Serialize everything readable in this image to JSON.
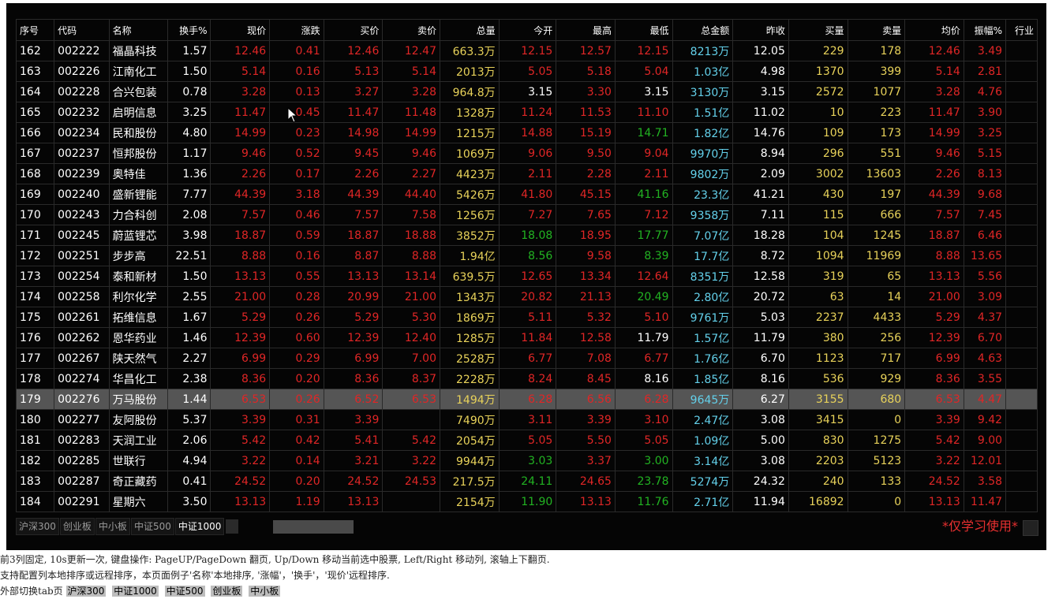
{
  "columns": [
    {
      "key": "no",
      "label": "序号"
    },
    {
      "key": "code",
      "label": "代码"
    },
    {
      "key": "name",
      "label": "名称"
    },
    {
      "key": "turnover",
      "label": "换手%"
    },
    {
      "key": "price",
      "label": "现价"
    },
    {
      "key": "change",
      "label": "涨跌"
    },
    {
      "key": "bid",
      "label": "买价"
    },
    {
      "key": "ask",
      "label": "卖价"
    },
    {
      "key": "volume",
      "label": "总量"
    },
    {
      "key": "open",
      "label": "今开"
    },
    {
      "key": "high",
      "label": "最高"
    },
    {
      "key": "low",
      "label": "最低"
    },
    {
      "key": "amount",
      "label": "总金额"
    },
    {
      "key": "prev_close",
      "label": "昨收"
    },
    {
      "key": "buy_vol",
      "label": "买量"
    },
    {
      "key": "sell_vol",
      "label": "卖量"
    },
    {
      "key": "avg",
      "label": "均价"
    },
    {
      "key": "amplitude",
      "label": "振幅%"
    },
    {
      "key": "industry",
      "label": "行业"
    }
  ],
  "colors": {
    "w": "#ffffff",
    "r": "#e02626",
    "g": "#22b322",
    "y": "#e8d25a",
    "c": "#63d0ea",
    "selected_row_bg": "#555555",
    "panel_bg": "#050505"
  },
  "selected_row": 17,
  "rows": [
    {
      "no": "162",
      "code": "002222",
      "name": "福晶科技",
      "turnover": "1.57",
      "price": "12.46",
      "change": "0.41",
      "bid": "12.46",
      "ask": "12.47",
      "volume": "663.3万",
      "open": "12.15",
      "high": "12.57",
      "low": "12.15",
      "amount": "8213万",
      "prev_close": "12.05",
      "buy_vol": "229",
      "sell_vol": "178",
      "avg": "12.46",
      "amplitude": "3.49",
      "industry": "",
      "colors": {
        "open": "r",
        "low": "r"
      }
    },
    {
      "no": "163",
      "code": "002226",
      "name": "江南化工",
      "turnover": "1.50",
      "price": "5.14",
      "change": "0.16",
      "bid": "5.13",
      "ask": "5.14",
      "volume": "2013万",
      "open": "5.05",
      "high": "5.18",
      "low": "5.04",
      "amount": "1.03亿",
      "prev_close": "4.98",
      "buy_vol": "1370",
      "sell_vol": "399",
      "avg": "5.14",
      "amplitude": "2.81",
      "industry": "",
      "colors": {
        "open": "r",
        "low": "r"
      }
    },
    {
      "no": "164",
      "code": "002228",
      "name": "合兴包装",
      "turnover": "0.78",
      "price": "3.28",
      "change": "0.13",
      "bid": "3.27",
      "ask": "3.28",
      "volume": "964.8万",
      "open": "3.15",
      "high": "3.30",
      "low": "3.15",
      "amount": "3130万",
      "prev_close": "3.15",
      "buy_vol": "2572",
      "sell_vol": "1077",
      "avg": "3.28",
      "amplitude": "4.76",
      "industry": "",
      "colors": {
        "open": "w",
        "low": "w"
      }
    },
    {
      "no": "165",
      "code": "002232",
      "name": "启明信息",
      "turnover": "3.25",
      "price": "11.47",
      "change": "0.45",
      "bid": "11.47",
      "ask": "11.48",
      "volume": "1328万",
      "open": "11.24",
      "high": "11.53",
      "low": "11.10",
      "amount": "1.51亿",
      "prev_close": "11.02",
      "buy_vol": "10",
      "sell_vol": "223",
      "avg": "11.47",
      "amplitude": "3.90",
      "industry": "",
      "colors": {
        "open": "r",
        "low": "r"
      }
    },
    {
      "no": "166",
      "code": "002234",
      "name": "民和股份",
      "turnover": "4.80",
      "price": "14.99",
      "change": "0.23",
      "bid": "14.98",
      "ask": "14.99",
      "volume": "1215万",
      "open": "14.88",
      "high": "15.19",
      "low": "14.71",
      "amount": "1.82亿",
      "prev_close": "14.76",
      "buy_vol": "109",
      "sell_vol": "173",
      "avg": "14.99",
      "amplitude": "3.25",
      "industry": "",
      "colors": {
        "open": "r",
        "low": "g"
      }
    },
    {
      "no": "167",
      "code": "002237",
      "name": "恒邦股份",
      "turnover": "1.17",
      "price": "9.46",
      "change": "0.52",
      "bid": "9.45",
      "ask": "9.46",
      "volume": "1069万",
      "open": "9.06",
      "high": "9.50",
      "low": "9.04",
      "amount": "9970万",
      "prev_close": "8.94",
      "buy_vol": "296",
      "sell_vol": "551",
      "avg": "9.46",
      "amplitude": "5.15",
      "industry": "",
      "colors": {
        "open": "r",
        "low": "r"
      }
    },
    {
      "no": "168",
      "code": "002239",
      "name": "奥特佳",
      "turnover": "1.36",
      "price": "2.26",
      "change": "0.17",
      "bid": "2.26",
      "ask": "2.27",
      "volume": "4423万",
      "open": "2.11",
      "high": "2.28",
      "low": "2.11",
      "amount": "9802万",
      "prev_close": "2.09",
      "buy_vol": "3002",
      "sell_vol": "13603",
      "avg": "2.26",
      "amplitude": "8.13",
      "industry": "",
      "colors": {
        "open": "r",
        "low": "r"
      }
    },
    {
      "no": "169",
      "code": "002240",
      "name": "盛新锂能",
      "turnover": "7.77",
      "price": "44.39",
      "change": "3.18",
      "bid": "44.39",
      "ask": "44.40",
      "volume": "5426万",
      "open": "41.80",
      "high": "45.15",
      "low": "41.16",
      "amount": "23.3亿",
      "prev_close": "41.21",
      "buy_vol": "430",
      "sell_vol": "197",
      "avg": "44.39",
      "amplitude": "9.68",
      "industry": "",
      "colors": {
        "open": "r",
        "low": "g"
      }
    },
    {
      "no": "170",
      "code": "002243",
      "name": "力合科创",
      "turnover": "2.08",
      "price": "7.57",
      "change": "0.46",
      "bid": "7.57",
      "ask": "7.58",
      "volume": "1256万",
      "open": "7.27",
      "high": "7.65",
      "low": "7.12",
      "amount": "9358万",
      "prev_close": "7.11",
      "buy_vol": "115",
      "sell_vol": "666",
      "avg": "7.57",
      "amplitude": "7.45",
      "industry": "",
      "colors": {
        "open": "r",
        "low": "r"
      }
    },
    {
      "no": "171",
      "code": "002245",
      "name": "蔚蓝锂芯",
      "turnover": "3.98",
      "price": "18.87",
      "change": "0.59",
      "bid": "18.87",
      "ask": "18.88",
      "volume": "3852万",
      "open": "18.08",
      "high": "18.95",
      "low": "17.77",
      "amount": "7.07亿",
      "prev_close": "18.28",
      "buy_vol": "104",
      "sell_vol": "1245",
      "avg": "18.87",
      "amplitude": "6.46",
      "industry": "",
      "colors": {
        "open": "g",
        "low": "g"
      }
    },
    {
      "no": "172",
      "code": "002251",
      "name": "步步高",
      "turnover": "22.51",
      "price": "8.88",
      "change": "0.16",
      "bid": "8.87",
      "ask": "8.88",
      "volume": "1.94亿",
      "open": "8.56",
      "high": "9.58",
      "low": "8.39",
      "amount": "17.7亿",
      "prev_close": "8.72",
      "buy_vol": "1094",
      "sell_vol": "11969",
      "avg": "8.88",
      "amplitude": "13.65",
      "industry": "",
      "colors": {
        "open": "g",
        "low": "g"
      }
    },
    {
      "no": "173",
      "code": "002254",
      "name": "泰和新材",
      "turnover": "1.50",
      "price": "13.13",
      "change": "0.55",
      "bid": "13.13",
      "ask": "13.14",
      "volume": "639.5万",
      "open": "12.65",
      "high": "13.34",
      "low": "12.64",
      "amount": "8351万",
      "prev_close": "12.58",
      "buy_vol": "319",
      "sell_vol": "65",
      "avg": "13.13",
      "amplitude": "5.56",
      "industry": "",
      "colors": {
        "open": "r",
        "low": "r"
      }
    },
    {
      "no": "174",
      "code": "002258",
      "name": "利尔化学",
      "turnover": "2.55",
      "price": "21.00",
      "change": "0.28",
      "bid": "20.99",
      "ask": "21.00",
      "volume": "1343万",
      "open": "20.82",
      "high": "21.13",
      "low": "20.49",
      "amount": "2.80亿",
      "prev_close": "20.72",
      "buy_vol": "63",
      "sell_vol": "14",
      "avg": "21.00",
      "amplitude": "3.09",
      "industry": "",
      "colors": {
        "open": "r",
        "low": "g"
      }
    },
    {
      "no": "175",
      "code": "002261",
      "name": "拓维信息",
      "turnover": "1.67",
      "price": "5.29",
      "change": "0.26",
      "bid": "5.29",
      "ask": "5.30",
      "volume": "1869万",
      "open": "5.11",
      "high": "5.32",
      "low": "5.10",
      "amount": "9761万",
      "prev_close": "5.03",
      "buy_vol": "2237",
      "sell_vol": "4433",
      "avg": "5.29",
      "amplitude": "4.37",
      "industry": "",
      "colors": {
        "open": "r",
        "low": "r"
      }
    },
    {
      "no": "176",
      "code": "002262",
      "name": "恩华药业",
      "turnover": "1.46",
      "price": "12.39",
      "change": "0.60",
      "bid": "12.39",
      "ask": "12.40",
      "volume": "1285万",
      "open": "11.84",
      "high": "12.58",
      "low": "11.79",
      "amount": "1.57亿",
      "prev_close": "11.79",
      "buy_vol": "380",
      "sell_vol": "256",
      "avg": "12.39",
      "amplitude": "6.70",
      "industry": "",
      "colors": {
        "open": "r",
        "low": "w"
      }
    },
    {
      "no": "177",
      "code": "002267",
      "name": "陕天然气",
      "turnover": "2.27",
      "price": "6.99",
      "change": "0.29",
      "bid": "6.99",
      "ask": "7.00",
      "volume": "2528万",
      "open": "6.77",
      "high": "7.08",
      "low": "6.77",
      "amount": "1.76亿",
      "prev_close": "6.70",
      "buy_vol": "1123",
      "sell_vol": "717",
      "avg": "6.99",
      "amplitude": "4.63",
      "industry": "",
      "colors": {
        "open": "r",
        "low": "r"
      }
    },
    {
      "no": "178",
      "code": "002274",
      "name": "华昌化工",
      "turnover": "2.38",
      "price": "8.36",
      "change": "0.20",
      "bid": "8.36",
      "ask": "8.37",
      "volume": "2228万",
      "open": "8.24",
      "high": "8.45",
      "low": "8.16",
      "amount": "1.85亿",
      "prev_close": "8.16",
      "buy_vol": "536",
      "sell_vol": "929",
      "avg": "8.36",
      "amplitude": "3.55",
      "industry": "",
      "colors": {
        "open": "r",
        "low": "w"
      }
    },
    {
      "no": "179",
      "code": "002276",
      "name": "万马股份",
      "turnover": "1.44",
      "price": "6.53",
      "change": "0.26",
      "bid": "6.52",
      "ask": "6.53",
      "volume": "1494万",
      "open": "6.28",
      "high": "6.56",
      "low": "6.28",
      "amount": "9645万",
      "prev_close": "6.27",
      "buy_vol": "3155",
      "sell_vol": "680",
      "avg": "6.53",
      "amplitude": "4.47",
      "industry": "",
      "colors": {
        "open": "r",
        "low": "r"
      }
    },
    {
      "no": "180",
      "code": "002277",
      "name": "友阿股份",
      "turnover": "5.37",
      "price": "3.39",
      "change": "0.31",
      "bid": "3.39",
      "ask": "",
      "volume": "7490万",
      "open": "3.11",
      "high": "3.39",
      "low": "3.10",
      "amount": "2.47亿",
      "prev_close": "3.08",
      "buy_vol": "3415",
      "sell_vol": "0",
      "avg": "3.39",
      "amplitude": "9.42",
      "industry": "",
      "colors": {
        "open": "r",
        "low": "r"
      }
    },
    {
      "no": "181",
      "code": "002283",
      "name": "天润工业",
      "turnover": "2.06",
      "price": "5.42",
      "change": "0.42",
      "bid": "5.41",
      "ask": "5.42",
      "volume": "2054万",
      "open": "5.05",
      "high": "5.50",
      "low": "5.05",
      "amount": "1.09亿",
      "prev_close": "5.00",
      "buy_vol": "830",
      "sell_vol": "1275",
      "avg": "5.42",
      "amplitude": "9.00",
      "industry": "",
      "colors": {
        "open": "r",
        "low": "r"
      }
    },
    {
      "no": "182",
      "code": "002285",
      "name": "世联行",
      "turnover": "4.94",
      "price": "3.22",
      "change": "0.14",
      "bid": "3.21",
      "ask": "3.22",
      "volume": "9944万",
      "open": "3.03",
      "high": "3.37",
      "low": "3.00",
      "amount": "3.14亿",
      "prev_close": "3.08",
      "buy_vol": "2203",
      "sell_vol": "5123",
      "avg": "3.22",
      "amplitude": "12.01",
      "industry": "",
      "colors": {
        "open": "g",
        "low": "g"
      }
    },
    {
      "no": "183",
      "code": "002287",
      "name": "奇正藏药",
      "turnover": "0.41",
      "price": "24.52",
      "change": "0.20",
      "bid": "24.52",
      "ask": "24.53",
      "volume": "217.5万",
      "open": "24.11",
      "high": "24.65",
      "low": "23.78",
      "amount": "5274万",
      "prev_close": "24.32",
      "buy_vol": "240",
      "sell_vol": "133",
      "avg": "24.52",
      "amplitude": "3.58",
      "industry": "",
      "colors": {
        "open": "g",
        "low": "g"
      }
    },
    {
      "no": "184",
      "code": "002291",
      "name": "星期六",
      "turnover": "3.50",
      "price": "13.13",
      "change": "1.19",
      "bid": "13.13",
      "ask": "",
      "volume": "2154万",
      "open": "11.90",
      "high": "13.13",
      "low": "11.76",
      "amount": "2.71亿",
      "prev_close": "11.94",
      "buy_vol": "16892",
      "sell_vol": "0",
      "avg": "13.13",
      "amplitude": "11.47",
      "industry": "",
      "colors": {
        "open": "g",
        "low": "g"
      }
    }
  ],
  "tabs": [
    {
      "label": "沪深300",
      "active": false
    },
    {
      "label": "创业板",
      "active": false
    },
    {
      "label": "中小板",
      "active": false
    },
    {
      "label": "中证500",
      "active": false
    },
    {
      "label": "中证1000",
      "active": true
    }
  ],
  "watermark": "*仅学习使用*",
  "help": {
    "line1": "前3列固定, 10s更新一次, 键盘操作: PageUP/PageDown 翻页, Up/Down 移动当前选中股票, Left/Right 移动列, 滚轴上下翻页.",
    "line2": "支持配置列本地排序或远程排序，本页面例子'名称'本地排序, '涨幅'，'换手'，'现价'远程排序.",
    "line3_label": "外部切换tab页",
    "external_tabs": [
      "沪深300",
      "中证1000",
      "中证500",
      "创业板",
      "中小板"
    ]
  }
}
